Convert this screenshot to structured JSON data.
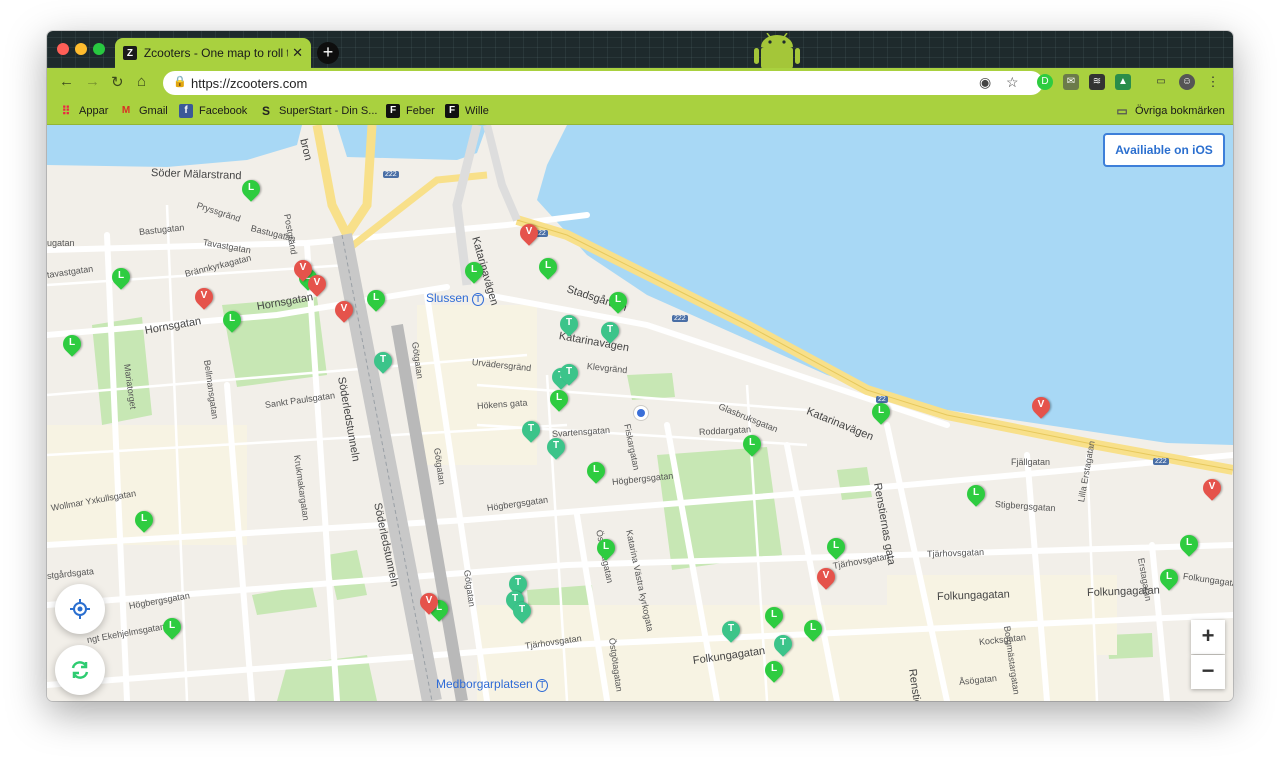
{
  "browser": {
    "tab_title": "Zcooters - One map to roll the",
    "tab_favicon": "Z",
    "url": "https://zcooters.com",
    "accent_color": "#a9d13f"
  },
  "bookmarks": [
    {
      "label": "Appar",
      "icon": "apps-grid-icon"
    },
    {
      "label": "Gmail",
      "icon": "gmail-icon"
    },
    {
      "label": "Facebook",
      "icon": "facebook-icon"
    },
    {
      "label": "SuperStart - Din S...",
      "icon": "superstart-icon"
    },
    {
      "label": "Feber",
      "icon": "feber-icon"
    },
    {
      "label": "Wille",
      "icon": "feber-icon"
    }
  ],
  "other_bookmarks": "Övriga bokmärken",
  "map": {
    "ios_button": "Availiable on iOS",
    "zoom_in": "+",
    "zoom_out": "−",
    "places": {
      "slussen": "Slussen",
      "medborgarplatsen": "Medborgarplatsen"
    },
    "streets": {
      "soder_malarstrand": "Söder Mälarstrand",
      "pryssgrand": "Pryssgränd",
      "bastugatan_1": "Bastugatan",
      "bastugatan_2": "Bastugatan",
      "postgrand": "Postgränd",
      "tavastgatan_1": "Tavastgatan",
      "tavastgatan_2": "Tavastgatan",
      "brannkyrkagatan": "Brännkyrkagatan",
      "hornsgatan_1": "Hornsgatan",
      "hornsgatan_2": "Hornsgatan",
      "bellmansgatan": "Bellmansgatan",
      "mariatorget": "Mariatorget",
      "sankt_paulsgatan": "Sankt Paulsgatan",
      "krukmakargatan": "Krukmakargatan",
      "soderledstunneln_1": "Söderledstunneln",
      "soderledstunneln_2": "Söderledstunneln",
      "gotgatan_1": "Götgatan",
      "gotgatan_2": "Götgatan",
      "gotgatan_3": "Götgatan",
      "urvadersgrand": "Urvädersgränd",
      "klevgrand": "Klevgränd",
      "hokens_gata": "Hökens gata",
      "svartensgatan": "Svartensgatan",
      "katarinavagen_1": "Katarinavägen",
      "katarinavagen_2": "Katarinavägen",
      "katarinavagen_3": "Katarinavägen",
      "stadsgarden": "Stadsgården",
      "glasbruksgatan": "Glasbruksgatan",
      "fiskargatan": "Fiskargatan",
      "roddargatan": "Roddargatan",
      "hogbergsgatan_1": "Högbergsgatan",
      "hogbergsgatan_2": "Högbergsgatan",
      "hogbergsgatan_3": "Högbergsgatan",
      "ostgotagatan_1": "Östgötagatan",
      "ostgotagatan_2": "Östgötagatan",
      "katarina_vastra": "Katarina Västra kyrkogata",
      "tjarhovsgatan_1": "Tjärhovsgatan",
      "tjarhovsgatan_2": "Tjärhovsgatan",
      "tjarhovsgatan_3": "Tjärhovsgatan",
      "folkungagatan_1": "Folkungagatan",
      "folkungagatan_2": "Folkungagatan",
      "folkungagatan_3": "Folkungagatan",
      "folkungagatan_4": "Folkungagatan",
      "renstiernas_gata_1": "Renstiernas gata",
      "renstiernas_gata_2": "Renstiernas g",
      "fjallgatan": "Fjällgatan",
      "stigbergsgatan": "Stigbergsgatan",
      "lilla_erstagatan": "Lilla Erstagatan",
      "erstagatan": "Erstagatan",
      "kocksgatan": "Kocksgatan",
      "borgmastargatan": "Borgmästargatan",
      "asogatan": "Åsögatan",
      "wollmar": "Wollmar Yxkullsgatan",
      "hogbergsgatan_w": "Högbergsgatan",
      "ekehjelmsgatan": "ngt Ekehjelmsgatan",
      "gardsgatan": "stgårdsgata",
      "ugatan": "ugatan",
      "tavastgatan_w": "tavastgatan",
      "bron": "bron"
    },
    "route_shields": [
      "222",
      "22",
      "222",
      "22",
      "222"
    ],
    "pins": [
      {
        "type": "L",
        "color": "#2ecc40"
      },
      {
        "type": "L",
        "color": "#2ecc40"
      },
      {
        "type": "L",
        "color": "#2ecc40"
      },
      {
        "type": "L",
        "color": "#2ecc40"
      },
      {
        "type": "L",
        "color": "#2ecc40"
      },
      {
        "type": "L",
        "color": "#2ecc40"
      },
      {
        "type": "L",
        "color": "#2ecc40"
      },
      {
        "type": "L",
        "color": "#2ecc40"
      },
      {
        "type": "L",
        "color": "#2ecc40"
      },
      {
        "type": "L",
        "color": "#2ecc40"
      },
      {
        "type": "L",
        "color": "#2ecc40"
      },
      {
        "type": "L",
        "color": "#2ecc40"
      },
      {
        "type": "L",
        "color": "#2ecc40"
      },
      {
        "type": "L",
        "color": "#2ecc40"
      },
      {
        "type": "L",
        "color": "#2ecc40"
      },
      {
        "type": "L",
        "color": "#2ecc40"
      },
      {
        "type": "L",
        "color": "#2ecc40"
      },
      {
        "type": "L",
        "color": "#2ecc40"
      },
      {
        "type": "L",
        "color": "#2ecc40"
      },
      {
        "type": "L",
        "color": "#2ecc40"
      },
      {
        "type": "L",
        "color": "#2ecc40"
      },
      {
        "type": "L",
        "color": "#2ecc40"
      },
      {
        "type": "L",
        "color": "#2ecc40"
      },
      {
        "type": "L",
        "color": "#2ecc40"
      },
      {
        "type": "V",
        "color": "#e5534b"
      },
      {
        "type": "V",
        "color": "#e5534b"
      },
      {
        "type": "V",
        "color": "#e5534b"
      },
      {
        "type": "V",
        "color": "#e5534b"
      },
      {
        "type": "V",
        "color": "#e5534b"
      },
      {
        "type": "V",
        "color": "#e5534b"
      },
      {
        "type": "V",
        "color": "#e5534b"
      },
      {
        "type": "V",
        "color": "#e5534b"
      },
      {
        "type": "V",
        "color": "#e5534b"
      },
      {
        "type": "T",
        "color": "#3cc48a"
      },
      {
        "type": "T",
        "color": "#3cc48a"
      },
      {
        "type": "T",
        "color": "#3cc48a"
      },
      {
        "type": "T",
        "color": "#3cc48a"
      },
      {
        "type": "T",
        "color": "#3cc48a"
      },
      {
        "type": "T",
        "color": "#3cc48a"
      },
      {
        "type": "T",
        "color": "#3cc48a"
      },
      {
        "type": "T",
        "color": "#3cc48a"
      },
      {
        "type": "T",
        "color": "#3cc48a"
      },
      {
        "type": "T",
        "color": "#3cc48a"
      },
      {
        "type": "T",
        "color": "#3cc48a"
      },
      {
        "type": "T",
        "color": "#3cc48a"
      }
    ],
    "water_color": "#a8d8f5",
    "park_color": "#c7e7b4",
    "road_yellow": "#f8e08a"
  }
}
